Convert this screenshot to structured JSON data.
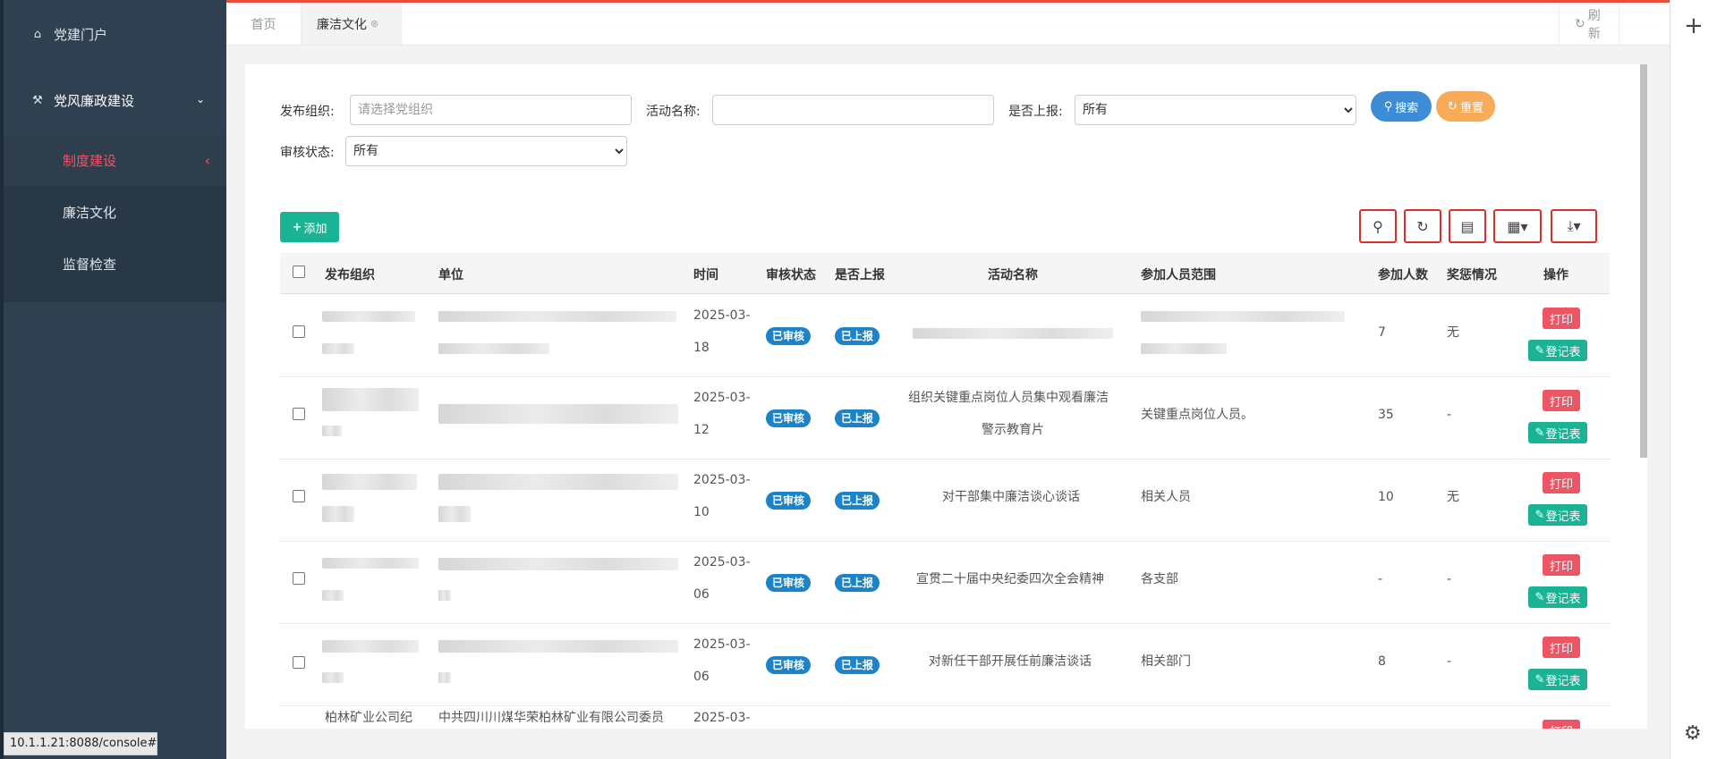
{
  "sidebar": {
    "portal": "党建门户",
    "party": "党风廉政建设",
    "sub_items": [
      "制度建设",
      "廉洁文化",
      "监督检查"
    ]
  },
  "tabs": {
    "home": "首页",
    "active": "廉洁文化",
    "refresh": "刷新"
  },
  "filters": {
    "org_label": "发布组织:",
    "org_placeholder": "请选择党组织",
    "activity_label": "活动名称:",
    "activity_value": "",
    "report_label": "是否上报:",
    "report_value": "所有",
    "audit_label": "审核状态:",
    "audit_value": "所有",
    "search_label": "搜索",
    "reset_label": "重置"
  },
  "toolbar": {
    "add_label": "添加"
  },
  "table": {
    "headers": [
      "发布组织",
      "单位",
      "时间",
      "审核状态",
      "是否上报",
      "活动名称",
      "参加人员范围",
      "参加人数",
      "奖惩情况",
      "操作"
    ],
    "rows": [
      {
        "date1": "2025-03-",
        "date2": "18",
        "audit": "已审核",
        "report": "已上报",
        "activity1": "",
        "activity2": "",
        "scope": "",
        "count": "7",
        "reward": "无"
      },
      {
        "date1": "2025-03-",
        "date2": "12",
        "audit": "已审核",
        "report": "已上报",
        "activity1": "组织关键重点岗位人员集中观看廉洁",
        "activity2": "警示教育片",
        "scope": "关键重点岗位人员。",
        "count": "35",
        "reward": "-"
      },
      {
        "date1": "2025-03-",
        "date2": "10",
        "audit": "已审核",
        "report": "已上报",
        "activity1": "对干部集中廉洁谈心谈话",
        "activity2": "",
        "scope": "相关人员",
        "count": "10",
        "reward": "无"
      },
      {
        "date1": "2025-03-",
        "date2": "06",
        "audit": "已审核",
        "report": "已上报",
        "activity1": "宣贯二十届中央纪委四次全会精神",
        "activity2": "",
        "scope": "各支部",
        "count": "-",
        "reward": "-"
      },
      {
        "date1": "2025-03-",
        "date2": "06",
        "audit": "已审核",
        "report": "已上报",
        "activity1": "对新任干部开展任前廉洁谈话",
        "activity2": "",
        "scope": "相关部门",
        "count": "8",
        "reward": "-"
      }
    ],
    "partial_row": {
      "org": "柏林矿业公司纪",
      "unit": "中共四川川煤华荣柏林矿业有限公司委员",
      "date": "2025-03-"
    },
    "print_label": "打印",
    "register_label": "登记表"
  },
  "statusbar": {
    "url": "10.1.1.21:8088/console#"
  },
  "colors": {
    "sidebar": "#2f4050",
    "accent_red": "#ed5565",
    "green": "#1ab394",
    "blue": "#1c84c6",
    "orange": "#f8ac59"
  }
}
